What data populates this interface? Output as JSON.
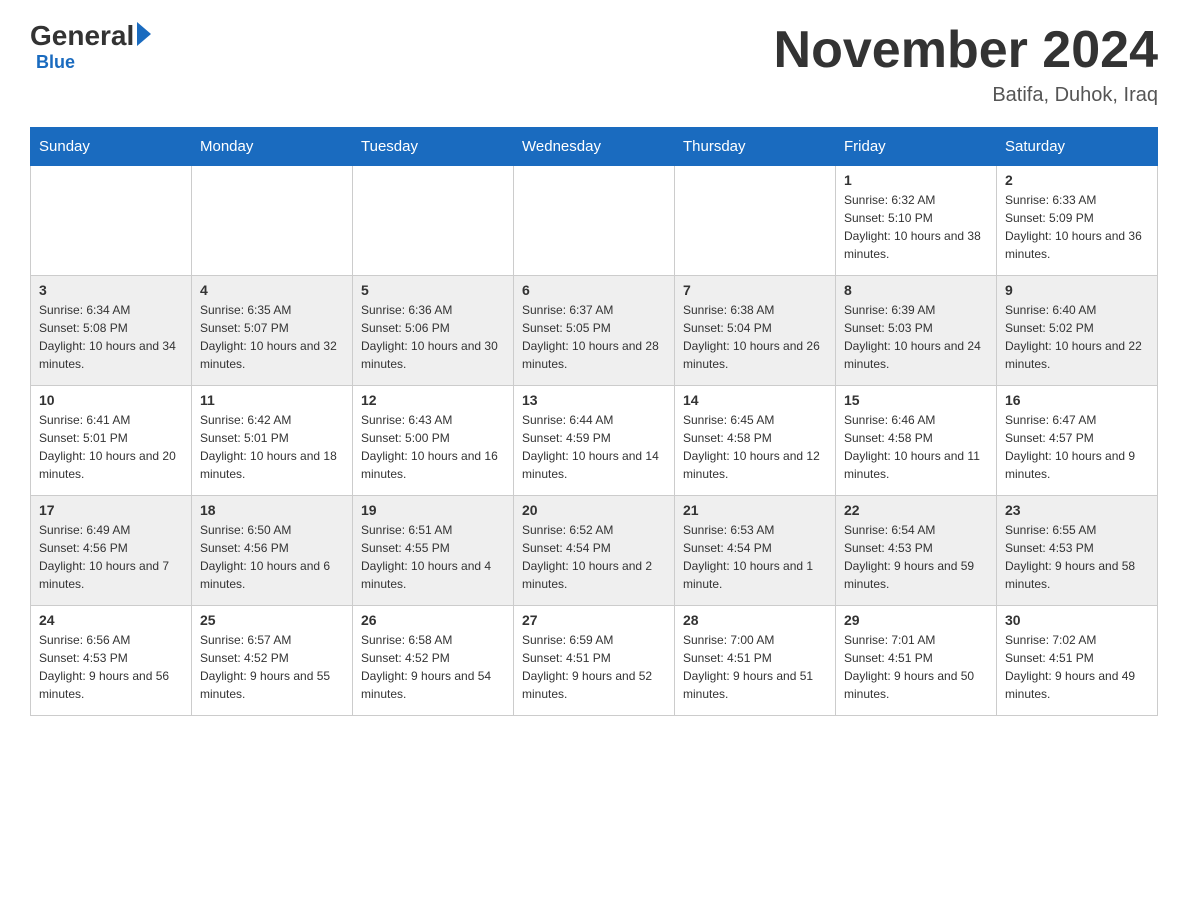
{
  "header": {
    "logo_main": "General",
    "logo_sub": "Blue",
    "month_title": "November 2024",
    "location": "Batifa, Duhok, Iraq"
  },
  "weekdays": [
    "Sunday",
    "Monday",
    "Tuesday",
    "Wednesday",
    "Thursday",
    "Friday",
    "Saturday"
  ],
  "rows": [
    {
      "cells": [
        {
          "day": "",
          "info": ""
        },
        {
          "day": "",
          "info": ""
        },
        {
          "day": "",
          "info": ""
        },
        {
          "day": "",
          "info": ""
        },
        {
          "day": "",
          "info": ""
        },
        {
          "day": "1",
          "info": "Sunrise: 6:32 AM\nSunset: 5:10 PM\nDaylight: 10 hours and 38 minutes."
        },
        {
          "day": "2",
          "info": "Sunrise: 6:33 AM\nSunset: 5:09 PM\nDaylight: 10 hours and 36 minutes."
        }
      ]
    },
    {
      "cells": [
        {
          "day": "3",
          "info": "Sunrise: 6:34 AM\nSunset: 5:08 PM\nDaylight: 10 hours and 34 minutes."
        },
        {
          "day": "4",
          "info": "Sunrise: 6:35 AM\nSunset: 5:07 PM\nDaylight: 10 hours and 32 minutes."
        },
        {
          "day": "5",
          "info": "Sunrise: 6:36 AM\nSunset: 5:06 PM\nDaylight: 10 hours and 30 minutes."
        },
        {
          "day": "6",
          "info": "Sunrise: 6:37 AM\nSunset: 5:05 PM\nDaylight: 10 hours and 28 minutes."
        },
        {
          "day": "7",
          "info": "Sunrise: 6:38 AM\nSunset: 5:04 PM\nDaylight: 10 hours and 26 minutes."
        },
        {
          "day": "8",
          "info": "Sunrise: 6:39 AM\nSunset: 5:03 PM\nDaylight: 10 hours and 24 minutes."
        },
        {
          "day": "9",
          "info": "Sunrise: 6:40 AM\nSunset: 5:02 PM\nDaylight: 10 hours and 22 minutes."
        }
      ]
    },
    {
      "cells": [
        {
          "day": "10",
          "info": "Sunrise: 6:41 AM\nSunset: 5:01 PM\nDaylight: 10 hours and 20 minutes."
        },
        {
          "day": "11",
          "info": "Sunrise: 6:42 AM\nSunset: 5:01 PM\nDaylight: 10 hours and 18 minutes."
        },
        {
          "day": "12",
          "info": "Sunrise: 6:43 AM\nSunset: 5:00 PM\nDaylight: 10 hours and 16 minutes."
        },
        {
          "day": "13",
          "info": "Sunrise: 6:44 AM\nSunset: 4:59 PM\nDaylight: 10 hours and 14 minutes."
        },
        {
          "day": "14",
          "info": "Sunrise: 6:45 AM\nSunset: 4:58 PM\nDaylight: 10 hours and 12 minutes."
        },
        {
          "day": "15",
          "info": "Sunrise: 6:46 AM\nSunset: 4:58 PM\nDaylight: 10 hours and 11 minutes."
        },
        {
          "day": "16",
          "info": "Sunrise: 6:47 AM\nSunset: 4:57 PM\nDaylight: 10 hours and 9 minutes."
        }
      ]
    },
    {
      "cells": [
        {
          "day": "17",
          "info": "Sunrise: 6:49 AM\nSunset: 4:56 PM\nDaylight: 10 hours and 7 minutes."
        },
        {
          "day": "18",
          "info": "Sunrise: 6:50 AM\nSunset: 4:56 PM\nDaylight: 10 hours and 6 minutes."
        },
        {
          "day": "19",
          "info": "Sunrise: 6:51 AM\nSunset: 4:55 PM\nDaylight: 10 hours and 4 minutes."
        },
        {
          "day": "20",
          "info": "Sunrise: 6:52 AM\nSunset: 4:54 PM\nDaylight: 10 hours and 2 minutes."
        },
        {
          "day": "21",
          "info": "Sunrise: 6:53 AM\nSunset: 4:54 PM\nDaylight: 10 hours and 1 minute."
        },
        {
          "day": "22",
          "info": "Sunrise: 6:54 AM\nSunset: 4:53 PM\nDaylight: 9 hours and 59 minutes."
        },
        {
          "day": "23",
          "info": "Sunrise: 6:55 AM\nSunset: 4:53 PM\nDaylight: 9 hours and 58 minutes."
        }
      ]
    },
    {
      "cells": [
        {
          "day": "24",
          "info": "Sunrise: 6:56 AM\nSunset: 4:53 PM\nDaylight: 9 hours and 56 minutes."
        },
        {
          "day": "25",
          "info": "Sunrise: 6:57 AM\nSunset: 4:52 PM\nDaylight: 9 hours and 55 minutes."
        },
        {
          "day": "26",
          "info": "Sunrise: 6:58 AM\nSunset: 4:52 PM\nDaylight: 9 hours and 54 minutes."
        },
        {
          "day": "27",
          "info": "Sunrise: 6:59 AM\nSunset: 4:51 PM\nDaylight: 9 hours and 52 minutes."
        },
        {
          "day": "28",
          "info": "Sunrise: 7:00 AM\nSunset: 4:51 PM\nDaylight: 9 hours and 51 minutes."
        },
        {
          "day": "29",
          "info": "Sunrise: 7:01 AM\nSunset: 4:51 PM\nDaylight: 9 hours and 50 minutes."
        },
        {
          "day": "30",
          "info": "Sunrise: 7:02 AM\nSunset: 4:51 PM\nDaylight: 9 hours and 49 minutes."
        }
      ]
    }
  ]
}
